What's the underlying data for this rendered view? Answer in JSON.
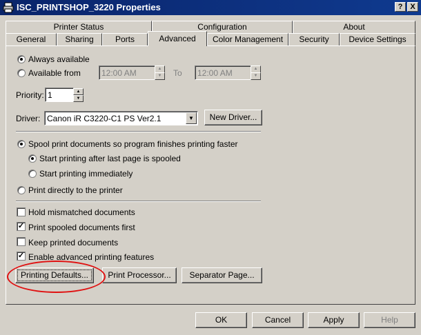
{
  "window": {
    "title": "ISC_PRINTSHOP_3220 Properties",
    "help_btn": "?",
    "close_btn": "X"
  },
  "tabs_row1": [
    "Printer Status",
    "Configuration",
    "About"
  ],
  "tabs_row2": [
    "General",
    "Sharing",
    "Ports",
    "Advanced",
    "Color Management",
    "Security",
    "Device Settings"
  ],
  "availability": {
    "always_label": "Always available",
    "from_label": "Available from",
    "from_time": "12:00 AM",
    "to_label": "To",
    "to_time": "12:00 AM",
    "selected": "always"
  },
  "priority": {
    "label": "Priority:",
    "value": "1"
  },
  "driver": {
    "label": "Driver:",
    "value": "Canon iR C3220-C1 PS Ver2.1",
    "new_driver_label": "New Driver..."
  },
  "spooling": {
    "spool_label": "Spool print documents so program finishes printing faster",
    "after_last_page_label": "Start printing after last page is spooled",
    "immediately_label": "Start printing immediately",
    "direct_label": "Print directly to the printer",
    "selected_mode": "spool",
    "selected_start": "after_last_page"
  },
  "options": [
    {
      "label": "Hold mismatched documents",
      "checked": false
    },
    {
      "label": "Print spooled documents first",
      "checked": true
    },
    {
      "label": "Keep printed documents",
      "checked": false
    },
    {
      "label": "Enable advanced printing features",
      "checked": true
    }
  ],
  "panel_buttons": {
    "printing_defaults": "Printing Defaults...",
    "print_processor": "Print Processor...",
    "separator_page": "Separator Page..."
  },
  "dialog_buttons": {
    "ok": "OK",
    "cancel": "Cancel",
    "apply": "Apply",
    "help": "Help"
  },
  "colors": {
    "titlebar": "#0a246a",
    "highlight_ring": "#e01010",
    "dialog_bg": "#d4d0c8"
  }
}
